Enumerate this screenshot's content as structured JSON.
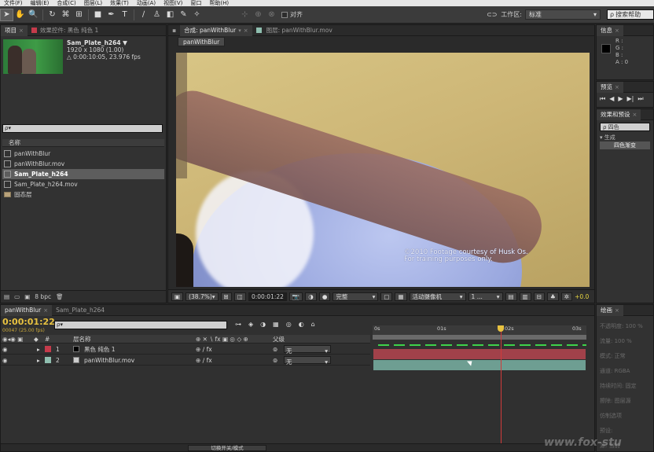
{
  "menu": [
    "文件(F)",
    "编辑(E)",
    "合成(C)",
    "图层(L)",
    "效果(T)",
    "动画(A)",
    "视图(V)",
    "窗口",
    "帮助(H)"
  ],
  "toolbar": {
    "snap_label": "对齐",
    "workspace_label": "工作区:",
    "workspace_value": "标准",
    "search_help_placeholder": "搜索帮助"
  },
  "project": {
    "tabs": [
      "项目",
      "效果控件: 黑色 纯色 1"
    ],
    "item_name": "Sam_Plate_h264 ▼",
    "item_dimensions": "1920 x 1080 (1.00)",
    "item_duration": "△ 0:00:10:05, 23.976 fps",
    "search_placeholder": "ρ▾",
    "column_name": "名称",
    "items": [
      {
        "name": "panWithBlur",
        "type": "comp"
      },
      {
        "name": "panWithBlur.mov",
        "type": "footage"
      },
      {
        "name": "Sam_Plate_h264",
        "type": "comp",
        "selected": true
      },
      {
        "name": "Sam_Plate_h264.mov",
        "type": "footage"
      },
      {
        "name": "固态层",
        "type": "folder"
      }
    ],
    "bpc": "8 bpc"
  },
  "comp": {
    "tabs": [
      "合成: panWithBlur",
      "图层: panWithBlur.mov"
    ],
    "subtab": "panWithBlur",
    "copyright_line1": "©2010 Footage courtesy of Husk Os.",
    "copyright_line2": "For training purposes only.",
    "zoom": "(38.7%)",
    "timecode": "0:00:01:22",
    "resolution": "完整",
    "camera": "活动摄像机",
    "views": "1 ...",
    "exposure": "+0.0"
  },
  "info": {
    "tab": "信息",
    "r": "R :",
    "g": "G :",
    "b": "B :",
    "a": "A : 0"
  },
  "preview": {
    "tab": "预览"
  },
  "effects": {
    "tab": "效果和预设",
    "search": "ρ 四色",
    "category": "▾ 生成",
    "item": "四色渐变"
  },
  "paragraph": {
    "tab": "绘画",
    "lines": [
      "不透明度: 100 %",
      "流量: 100 %",
      "模式: 正常",
      "通道: RGBA",
      "持续时间: 固定",
      "擦除: 图层源",
      "仿制选项",
      "预设:",
      "源: 当前"
    ]
  },
  "timeline": {
    "tabs": [
      "panWithBlur",
      "Sam_Plate_h264"
    ],
    "timecode": "0:00:01:22",
    "timecode_sub": "00047 (25.00 fps)",
    "search_placeholder": "ρ▾",
    "col_layer_name": "层名称",
    "col_parent": "父级",
    "layers": [
      {
        "num": "1",
        "name": "黑色 纯色 1",
        "color": "#c53b4b",
        "parent": "无"
      },
      {
        "num": "2",
        "name": "panWithBlur.mov",
        "color": "#8fbfb0",
        "parent": "无"
      }
    ],
    "ruler": [
      "0s",
      "01s",
      "02s",
      "03s"
    ],
    "footer_toggle": "切换开关/模式"
  },
  "watermark": "www.fox-stu"
}
